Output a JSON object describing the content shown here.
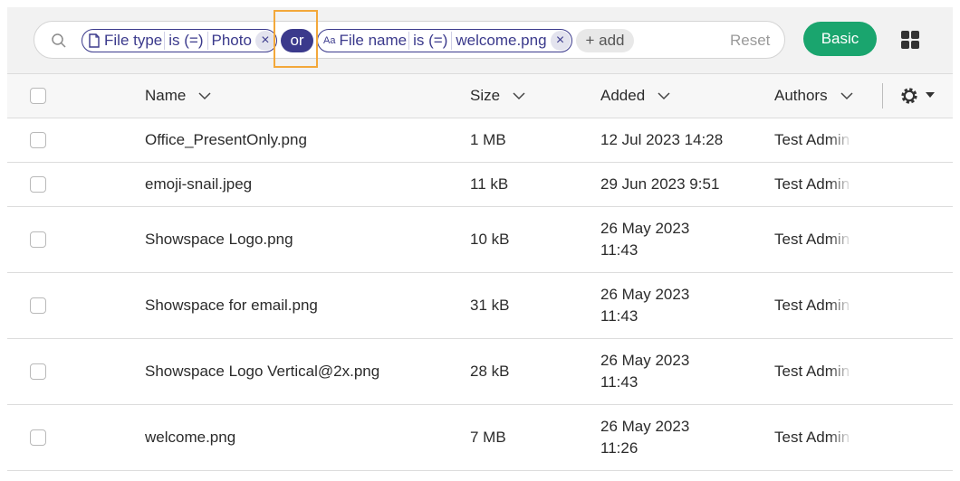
{
  "search": {
    "chip1": {
      "field": "File type",
      "op": "is (=)",
      "value": "Photo",
      "icon": "file-icon",
      "remove": "×"
    },
    "or_label": "or",
    "chip2": {
      "field": "File name",
      "op": "is (=)",
      "value": "welcome.png",
      "icon_text": "Aa",
      "remove": "×"
    },
    "add_label": "+ add",
    "reset_label": "Reset"
  },
  "toolbar": {
    "basic_label": "Basic"
  },
  "colors": {
    "accent": "#3b3a8c",
    "green": "#1aa56e",
    "highlight": "#f3a83a"
  },
  "table": {
    "headers": {
      "name": "Name",
      "size": "Size",
      "added": "Added",
      "authors": "Authors"
    },
    "rows": [
      {
        "name": "Office_PresentOnly.png",
        "size": "1 MB",
        "added1": "12 Jul 2023 14:28",
        "added2": "",
        "author": "Test Admin"
      },
      {
        "name": "emoji-snail.jpeg",
        "size": "11 kB",
        "added1": "29 Jun 2023 9:51",
        "added2": "",
        "author": "Test Admin"
      },
      {
        "name": "Showspace Logo.png",
        "size": "10 kB",
        "added1": "26 May 2023",
        "added2": "11:43",
        "author": "Test Admin"
      },
      {
        "name": "Showspace for email.png",
        "size": "31 kB",
        "added1": "26 May 2023",
        "added2": "11:43",
        "author": "Test Admin"
      },
      {
        "name": "Showspace Logo Vertical@2x.png",
        "size": "28 kB",
        "added1": "26 May 2023",
        "added2": "11:43",
        "author": "Test Admin"
      },
      {
        "name": "welcome.png",
        "size": "7 MB",
        "added1": "26 May 2023",
        "added2": "11:26",
        "author": "Test Admin"
      }
    ]
  }
}
